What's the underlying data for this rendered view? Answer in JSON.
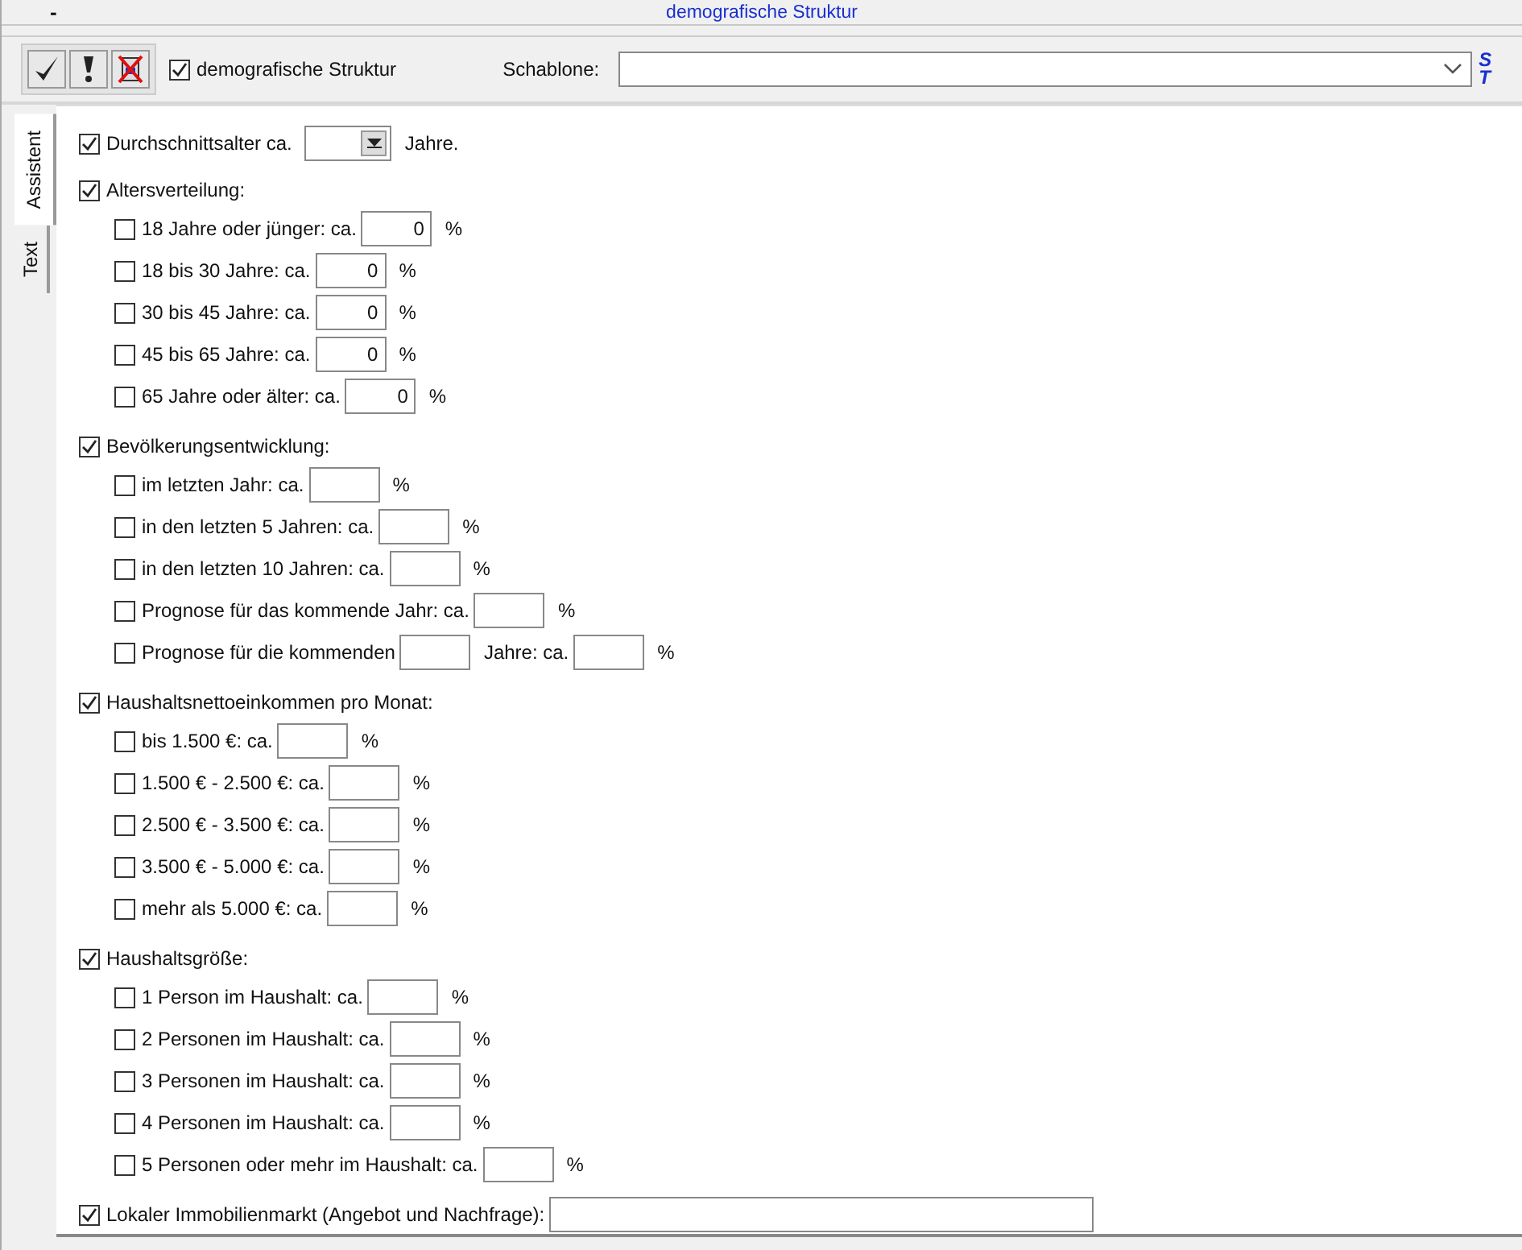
{
  "window": {
    "title": "demografische Struktur",
    "minimize": "-"
  },
  "toolbar": {
    "active_checkbox": {
      "label": "demografische Struktur",
      "checked": true
    },
    "template_label": "Schablone:",
    "side_letters": [
      "S",
      "T"
    ]
  },
  "tabs": [
    {
      "label": "Assistent",
      "selected": true
    },
    {
      "label": "Text",
      "selected": false
    }
  ],
  "sections": [
    {
      "checked": true,
      "segments": [
        {
          "kind": "text",
          "text": "Durchschnittsalter ca."
        },
        {
          "kind": "dropdown"
        },
        {
          "kind": "text",
          "text": "Jahre."
        }
      ]
    },
    {
      "checked": true,
      "segments": [
        {
          "kind": "text",
          "text": "Altersverteilung:"
        }
      ],
      "items": [
        {
          "checked": false,
          "segments": [
            {
              "kind": "text",
              "text": "18 Jahre oder jünger: ca."
            },
            {
              "kind": "field",
              "value": "0"
            },
            {
              "kind": "text",
              "text": "%"
            }
          ]
        },
        {
          "checked": false,
          "segments": [
            {
              "kind": "text",
              "text": "18 bis 30 Jahre: ca."
            },
            {
              "kind": "field",
              "value": "0"
            },
            {
              "kind": "text",
              "text": "%"
            }
          ]
        },
        {
          "checked": false,
          "segments": [
            {
              "kind": "text",
              "text": "30 bis 45 Jahre: ca."
            },
            {
              "kind": "field",
              "value": "0"
            },
            {
              "kind": "text",
              "text": "%"
            }
          ]
        },
        {
          "checked": false,
          "segments": [
            {
              "kind": "text",
              "text": "45 bis 65 Jahre: ca."
            },
            {
              "kind": "field",
              "value": "0"
            },
            {
              "kind": "text",
              "text": "%"
            }
          ]
        },
        {
          "checked": false,
          "segments": [
            {
              "kind": "text",
              "text": "65 Jahre oder älter: ca."
            },
            {
              "kind": "field",
              "value": "0"
            },
            {
              "kind": "text",
              "text": "%"
            }
          ]
        }
      ]
    },
    {
      "checked": true,
      "segments": [
        {
          "kind": "text",
          "text": "Bevölkerungsentwicklung:"
        }
      ],
      "items": [
        {
          "checked": false,
          "segments": [
            {
              "kind": "text",
              "text": "im letzten Jahr: ca."
            },
            {
              "kind": "field"
            },
            {
              "kind": "text",
              "text": "%"
            }
          ]
        },
        {
          "checked": false,
          "segments": [
            {
              "kind": "text",
              "text": "in den letzten 5 Jahren: ca."
            },
            {
              "kind": "field"
            },
            {
              "kind": "text",
              "text": "%"
            }
          ]
        },
        {
          "checked": false,
          "segments": [
            {
              "kind": "text",
              "text": "in den letzten 10 Jahren: ca."
            },
            {
              "kind": "field"
            },
            {
              "kind": "text",
              "text": "%"
            }
          ]
        },
        {
          "checked": false,
          "segments": [
            {
              "kind": "text",
              "text": "Prognose für das kommende Jahr: ca."
            },
            {
              "kind": "field"
            },
            {
              "kind": "text",
              "text": "%"
            }
          ]
        },
        {
          "checked": false,
          "segments": [
            {
              "kind": "text",
              "text": "Prognose für die kommenden"
            },
            {
              "kind": "field"
            },
            {
              "kind": "text",
              "text": "Jahre: ca."
            },
            {
              "kind": "field"
            },
            {
              "kind": "text",
              "text": "%"
            }
          ]
        }
      ]
    },
    {
      "checked": true,
      "segments": [
        {
          "kind": "text",
          "text": "Haushaltsnettoeinkommen pro Monat:"
        }
      ],
      "items": [
        {
          "checked": false,
          "segments": [
            {
              "kind": "text",
              "text": "bis 1.500 €: ca."
            },
            {
              "kind": "field"
            },
            {
              "kind": "text",
              "text": "%"
            }
          ]
        },
        {
          "checked": false,
          "segments": [
            {
              "kind": "text",
              "text": "1.500 € - 2.500 €: ca."
            },
            {
              "kind": "field"
            },
            {
              "kind": "text",
              "text": "%"
            }
          ]
        },
        {
          "checked": false,
          "segments": [
            {
              "kind": "text",
              "text": "2.500 € - 3.500 €: ca."
            },
            {
              "kind": "field"
            },
            {
              "kind": "text",
              "text": "%"
            }
          ]
        },
        {
          "checked": false,
          "segments": [
            {
              "kind": "text",
              "text": "3.500 € - 5.000 €: ca."
            },
            {
              "kind": "field"
            },
            {
              "kind": "text",
              "text": "%"
            }
          ]
        },
        {
          "checked": false,
          "segments": [
            {
              "kind": "text",
              "text": "mehr als 5.000 €: ca."
            },
            {
              "kind": "field"
            },
            {
              "kind": "text",
              "text": "%"
            }
          ]
        }
      ]
    },
    {
      "checked": true,
      "segments": [
        {
          "kind": "text",
          "text": "Haushaltsgröße:"
        }
      ],
      "items": [
        {
          "checked": false,
          "segments": [
            {
              "kind": "text",
              "text": "1 Person im Haushalt: ca."
            },
            {
              "kind": "field"
            },
            {
              "kind": "text",
              "text": "%"
            }
          ]
        },
        {
          "checked": false,
          "segments": [
            {
              "kind": "text",
              "text": "2 Personen im Haushalt: ca."
            },
            {
              "kind": "field"
            },
            {
              "kind": "text",
              "text": "%"
            }
          ]
        },
        {
          "checked": false,
          "segments": [
            {
              "kind": "text",
              "text": "3 Personen im Haushalt: ca."
            },
            {
              "kind": "field"
            },
            {
              "kind": "text",
              "text": "%"
            }
          ]
        },
        {
          "checked": false,
          "segments": [
            {
              "kind": "text",
              "text": "4 Personen im Haushalt: ca."
            },
            {
              "kind": "field"
            },
            {
              "kind": "text",
              "text": "%"
            }
          ]
        },
        {
          "checked": false,
          "segments": [
            {
              "kind": "text",
              "text": "5 Personen oder mehr im Haushalt: ca."
            },
            {
              "kind": "field"
            },
            {
              "kind": "text",
              "text": "%"
            }
          ]
        }
      ]
    },
    {
      "checked": true,
      "segments": [
        {
          "kind": "text",
          "text": "Lokaler Immobilienmarkt (Angebot und Nachfrage):"
        },
        {
          "kind": "wide-field"
        }
      ]
    }
  ]
}
